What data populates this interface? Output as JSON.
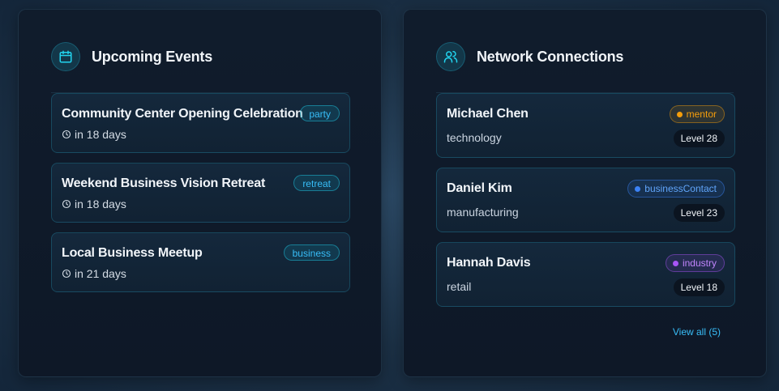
{
  "events_panel": {
    "title": "Upcoming Events",
    "icon": "calendar-icon",
    "events": [
      {
        "title": "Community Center Opening Celebration",
        "when": "in 18 days",
        "tag": "party"
      },
      {
        "title": "Weekend Business Vision Retreat",
        "when": "in 18 days",
        "tag": "retreat"
      },
      {
        "title": "Local Business Meetup",
        "when": "in 21 days",
        "tag": "business"
      }
    ]
  },
  "connections_panel": {
    "title": "Network Connections",
    "icon": "users-icon",
    "connections": [
      {
        "name": "Michael Chen",
        "field": "technology",
        "role": "mentor",
        "level": "Level 28",
        "role_color": "#f59e0b"
      },
      {
        "name": "Daniel Kim",
        "field": "manufacturing",
        "role": "businessContact",
        "level": "Level 23",
        "role_color": "#3b82f6"
      },
      {
        "name": "Hannah Davis",
        "field": "retail",
        "role": "industry",
        "level": "Level 18",
        "role_color": "#a855f7"
      }
    ],
    "view_all": "View all (5)"
  },
  "colors": {
    "accent": "#22d3ee",
    "link": "#38bdf8",
    "panel_bg": "#101c2c"
  }
}
